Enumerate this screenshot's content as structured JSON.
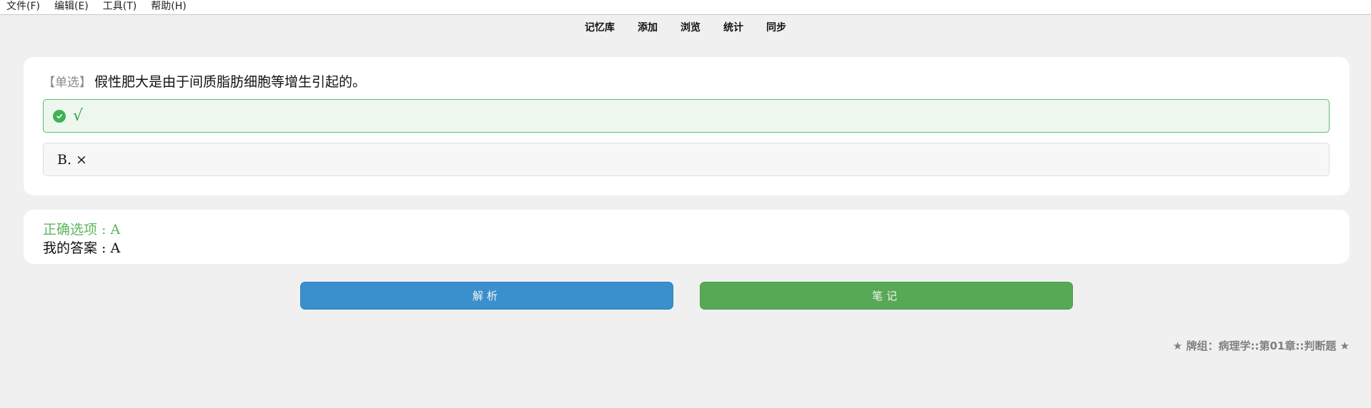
{
  "menu": [
    {
      "label": "文件(F)"
    },
    {
      "label": "编辑(E)"
    },
    {
      "label": "工具(T)"
    },
    {
      "label": "帮助(H)"
    }
  ],
  "toolbar": [
    {
      "label": "记忆库"
    },
    {
      "label": "添加"
    },
    {
      "label": "浏览"
    },
    {
      "label": "统计"
    },
    {
      "label": "同步"
    }
  ],
  "question": {
    "tag": "【单选】",
    "text": "假性肥大是由于间质脂肪细胞等增生引起的。"
  },
  "options": [
    {
      "text": "√",
      "state": "correct",
      "icon": "check-circle-icon"
    },
    {
      "text": "B. ×",
      "state": "normal"
    }
  ],
  "answer": {
    "correct": "正确选项 : A",
    "mine": "我的答案 : A"
  },
  "buttons": {
    "parse": "解析",
    "note": "笔记"
  },
  "deck": "★ 牌组：病理学::第01章::判断题 ★",
  "colors": {
    "correct_green": "#3fb255",
    "parse_blue": "#3a90cc",
    "note_green": "#58a955"
  }
}
